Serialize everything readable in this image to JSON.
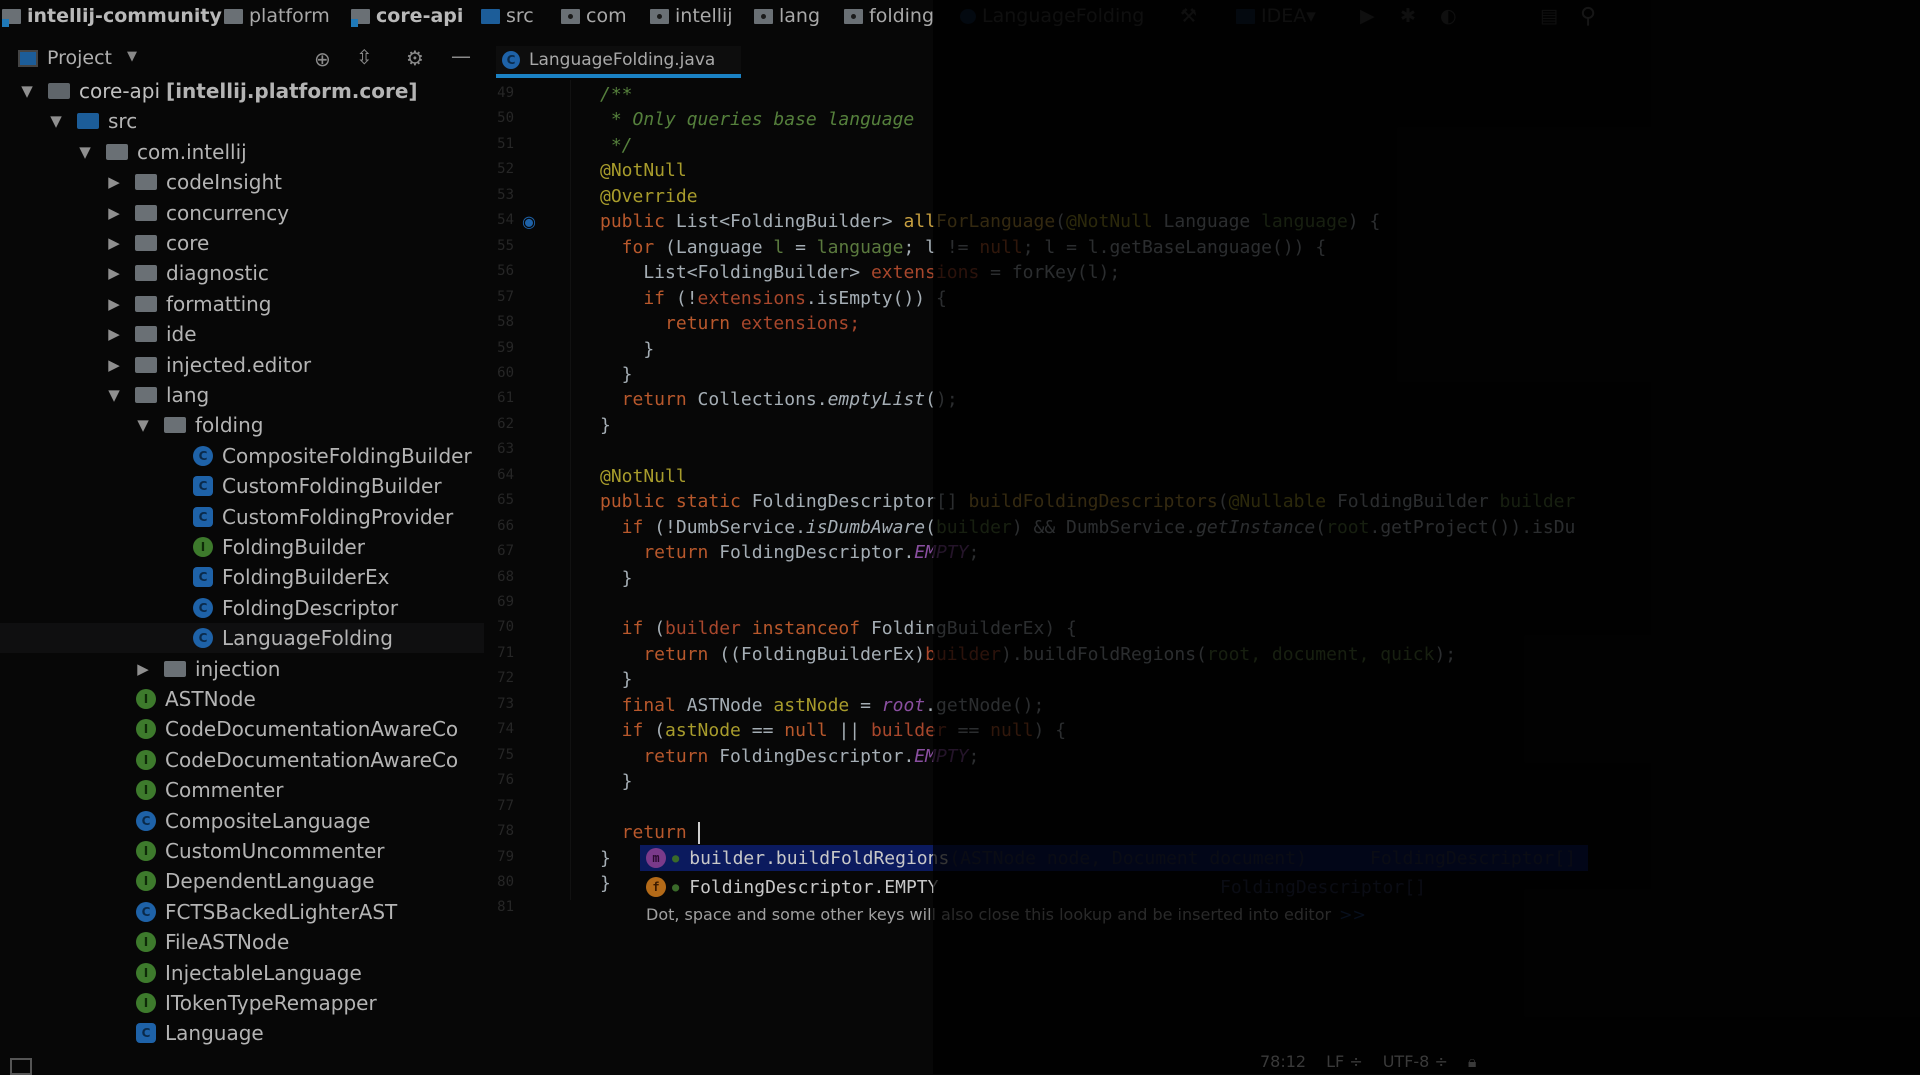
{
  "navbar": {
    "crumbs": [
      {
        "label": "intellij-community",
        "kind": "mod",
        "bold": true
      },
      {
        "label": "platform",
        "kind": "plain",
        "bold": false
      },
      {
        "label": "core-api",
        "kind": "mod",
        "bold": true
      },
      {
        "label": "src",
        "kind": "src",
        "bold": false
      },
      {
        "label": "com",
        "kind": "pkg",
        "bold": false
      },
      {
        "label": "intellij",
        "kind": "pkg",
        "bold": false
      },
      {
        "label": "lang",
        "kind": "pkg",
        "bold": false
      },
      {
        "label": "folding",
        "kind": "pkg",
        "bold": false
      },
      {
        "label": "LanguageFolding",
        "kind": "class",
        "bold": false
      }
    ],
    "run_config": "IDEA"
  },
  "project_panel": {
    "title": "Project",
    "tree": [
      {
        "label": "core-api",
        "suffix": "[intellij.platform.core]",
        "level": 0,
        "arrow": "down",
        "icon": "module"
      },
      {
        "label": "src",
        "level": 1,
        "arrow": "down",
        "icon": "src"
      },
      {
        "label": "com.intellij",
        "level": 2,
        "arrow": "down",
        "icon": "folder"
      },
      {
        "label": "codeInsight",
        "level": 3,
        "arrow": "right",
        "icon": "folder"
      },
      {
        "label": "concurrency",
        "level": 3,
        "arrow": "right",
        "icon": "folder"
      },
      {
        "label": "core",
        "level": 3,
        "arrow": "right",
        "icon": "folder"
      },
      {
        "label": "diagnostic",
        "level": 3,
        "arrow": "right",
        "icon": "folder"
      },
      {
        "label": "formatting",
        "level": 3,
        "arrow": "right",
        "icon": "folder"
      },
      {
        "label": "ide",
        "level": 3,
        "arrow": "right",
        "icon": "folder"
      },
      {
        "label": "injected.editor",
        "level": 3,
        "arrow": "right",
        "icon": "folder"
      },
      {
        "label": "lang",
        "level": 3,
        "arrow": "down",
        "icon": "folder"
      },
      {
        "label": "folding",
        "level": 4,
        "arrow": "down",
        "icon": "folder"
      },
      {
        "label": "CompositeFoldingBuilder",
        "level": 5,
        "icon": "c"
      },
      {
        "label": "CustomFoldingBuilder",
        "level": 5,
        "icon": "cabs"
      },
      {
        "label": "CustomFoldingProvider",
        "level": 5,
        "icon": "cabs"
      },
      {
        "label": "FoldingBuilder",
        "level": 5,
        "icon": "i"
      },
      {
        "label": "FoldingBuilderEx",
        "level": 5,
        "icon": "cabs"
      },
      {
        "label": "FoldingDescriptor",
        "level": 5,
        "icon": "c"
      },
      {
        "label": "LanguageFolding",
        "level": 5,
        "icon": "c",
        "selected": true
      },
      {
        "label": "injection",
        "level": 4,
        "arrow": "right",
        "icon": "folder"
      },
      {
        "label": "ASTNode",
        "level": 4,
        "icon": "i"
      },
      {
        "label": "CodeDocumentationAwareCo",
        "level": 4,
        "icon": "i"
      },
      {
        "label": "CodeDocumentationAwareCo",
        "level": 4,
        "icon": "i"
      },
      {
        "label": "Commenter",
        "level": 4,
        "icon": "i"
      },
      {
        "label": "CompositeLanguage",
        "level": 4,
        "icon": "c"
      },
      {
        "label": "CustomUncommenter",
        "level": 4,
        "icon": "i"
      },
      {
        "label": "DependentLanguage",
        "level": 4,
        "icon": "i"
      },
      {
        "label": "FCTSBackedLighterAST",
        "level": 4,
        "icon": "c"
      },
      {
        "label": "FileASTNode",
        "level": 4,
        "icon": "i"
      },
      {
        "label": "InjectableLanguage",
        "level": 4,
        "icon": "i"
      },
      {
        "label": "ITokenTypeRemapper",
        "level": 4,
        "icon": "i"
      },
      {
        "label": "Language",
        "level": 4,
        "icon": "cabs"
      }
    ]
  },
  "editor": {
    "tab_label": "LanguageFolding.java",
    "lines": [
      {
        "n": "49",
        "t": [
          [
            "/**",
            "cm"
          ]
        ]
      },
      {
        "n": "50",
        "t": [
          [
            " * Only queries base language",
            "cm"
          ]
        ]
      },
      {
        "n": "51",
        "t": [
          [
            " */",
            "cm"
          ]
        ]
      },
      {
        "n": "52",
        "t": [
          [
            "@NotNull",
            "an"
          ]
        ]
      },
      {
        "n": "53",
        "t": [
          [
            "@Override",
            "an"
          ]
        ]
      },
      {
        "n": "54",
        "t": [
          [
            "public ",
            "kw"
          ],
          [
            "List<FoldingBuilder> ",
            ""
          ],
          [
            "allForLanguage",
            "fn"
          ],
          [
            "(",
            ""
          ],
          [
            "@NotNull ",
            "an"
          ],
          [
            "Language ",
            ""
          ],
          [
            "language",
            "pm"
          ],
          [
            ") {",
            ""
          ]
        ]
      },
      {
        "n": "55",
        "t": [
          [
            "  for ",
            "kw"
          ],
          [
            "(Language ",
            ""
          ],
          [
            "l",
            "pm"
          ],
          [
            " = ",
            ""
          ],
          [
            "language",
            "pm"
          ],
          [
            "; ",
            ""
          ],
          [
            "l",
            ""
          ],
          [
            " != ",
            ""
          ],
          [
            "null",
            "kw"
          ],
          [
            "; ",
            ""
          ],
          [
            "l",
            ""
          ],
          [
            " = ",
            ""
          ],
          [
            "l",
            ""
          ],
          [
            ".getBaseLanguage()) {",
            ""
          ]
        ]
      },
      {
        "n": "56",
        "t": [
          [
            "    List<FoldingBuilder> ",
            ""
          ],
          [
            "extensions",
            "lv"
          ],
          [
            " = forKey(",
            ""
          ],
          [
            "l",
            ""
          ],
          [
            ");",
            ""
          ]
        ]
      },
      {
        "n": "57",
        "t": [
          [
            "    if ",
            "kw"
          ],
          [
            "(!",
            ""
          ],
          [
            "extensions",
            "lv"
          ],
          [
            ".isEmpty()) {",
            ""
          ]
        ]
      },
      {
        "n": "58",
        "t": [
          [
            "      return ",
            "kw"
          ],
          [
            "extensions;",
            "lv"
          ]
        ]
      },
      {
        "n": "59",
        "t": [
          [
            "    }",
            ""
          ]
        ]
      },
      {
        "n": "60",
        "t": [
          [
            "  }",
            ""
          ]
        ]
      },
      {
        "n": "61",
        "t": [
          [
            "  return ",
            "kw"
          ],
          [
            "Collections.",
            ""
          ],
          [
            "emptyList",
            "it"
          ],
          [
            "();",
            ""
          ]
        ]
      },
      {
        "n": "62",
        "t": [
          [
            "}",
            ""
          ]
        ]
      },
      {
        "n": "63",
        "t": []
      },
      {
        "n": "64",
        "t": [
          [
            "@NotNull",
            "an"
          ]
        ]
      },
      {
        "n": "65",
        "t": [
          [
            "public static ",
            "kw"
          ],
          [
            "FoldingDescriptor[] ",
            ""
          ],
          [
            "buildFoldingDescriptors",
            "fn"
          ],
          [
            "(",
            ""
          ],
          [
            "@Nullable ",
            "an"
          ],
          [
            "FoldingBuilder ",
            ""
          ],
          [
            "builder",
            "pm"
          ]
        ]
      },
      {
        "n": "66",
        "t": [
          [
            "  if ",
            "kw"
          ],
          [
            "(!DumbService.",
            ""
          ],
          [
            "isDumbAware",
            "it"
          ],
          [
            "(",
            ""
          ],
          [
            "builder",
            "pm"
          ],
          [
            ") && DumbService.",
            ""
          ],
          [
            "getInstance",
            "it"
          ],
          [
            "(",
            ""
          ],
          [
            "root",
            "pm"
          ],
          [
            ".getProject()).isDu",
            ""
          ]
        ]
      },
      {
        "n": "67",
        "t": [
          [
            "    return ",
            "kw"
          ],
          [
            "FoldingDescriptor.",
            ""
          ],
          [
            "EMPTY",
            "st"
          ],
          [
            ";",
            ""
          ]
        ]
      },
      {
        "n": "68",
        "t": [
          [
            "  }",
            ""
          ]
        ]
      },
      {
        "n": "69",
        "t": []
      },
      {
        "n": "70",
        "t": [
          [
            "  if ",
            "kw"
          ],
          [
            "(",
            ""
          ],
          [
            "builder ",
            "lv"
          ],
          [
            "instanceof ",
            "kw"
          ],
          [
            "FoldingBuilderEx) {",
            ""
          ]
        ]
      },
      {
        "n": "71",
        "t": [
          [
            "    return ",
            "kw"
          ],
          [
            "((FoldingBuilderEx)",
            ""
          ],
          [
            "builder",
            "lv"
          ],
          [
            ").buildFoldRegions(",
            ""
          ],
          [
            "root, document, quick",
            "pm"
          ],
          [
            ");",
            ""
          ]
        ]
      },
      {
        "n": "72",
        "t": [
          [
            "  }",
            ""
          ]
        ]
      },
      {
        "n": "73",
        "t": [
          [
            "  final ",
            "kw"
          ],
          [
            "ASTNode ",
            ""
          ],
          [
            "astNode",
            "an"
          ],
          [
            " = ",
            ""
          ],
          [
            "root",
            "st"
          ],
          [
            ".getNode();",
            ""
          ]
        ]
      },
      {
        "n": "74",
        "t": [
          [
            "  if ",
            "kw"
          ],
          [
            "(",
            ""
          ],
          [
            "astNode",
            "an"
          ],
          [
            " == ",
            ""
          ],
          [
            "null ",
            "kw"
          ],
          [
            "|| ",
            ""
          ],
          [
            "builder",
            "lv"
          ],
          [
            " == ",
            ""
          ],
          [
            "null",
            "kw"
          ],
          [
            ") {",
            ""
          ]
        ]
      },
      {
        "n": "75",
        "t": [
          [
            "    return ",
            "kw"
          ],
          [
            "FoldingDescriptor.",
            ""
          ],
          [
            "EMPTY",
            "st"
          ],
          [
            ";",
            ""
          ]
        ]
      },
      {
        "n": "76",
        "t": [
          [
            "  }",
            ""
          ]
        ]
      },
      {
        "n": "77",
        "t": []
      },
      {
        "n": "78",
        "t": [
          [
            "  return ",
            "kw"
          ]
        ],
        "caret": true
      },
      {
        "n": "79",
        "t": [
          [
            "}",
            ""
          ]
        ]
      },
      {
        "n": "80",
        "t": [
          [
            "}",
            ""
          ]
        ]
      },
      {
        "n": "81",
        "t": []
      }
    ]
  },
  "completion": {
    "items": [
      {
        "icon": "m",
        "text": "builder.buildFoldRegions",
        "params": "(ASTNode node, Document document)",
        "type": "FoldingDescriptor[]",
        "selected": true
      },
      {
        "icon": "f",
        "text": "FoldingDescriptor.EMPTY",
        "params": "",
        "type": "FoldingDescriptor[]",
        "selected": false
      }
    ],
    "hint": "Dot, space and some other keys will also close this lookup and be inserted into editor",
    "hint_link": ">>"
  },
  "status": {
    "position": "78:12",
    "line_sep": "LF ÷",
    "encoding": "UTF-8 ÷"
  },
  "colors": {
    "accent": "#1b82c4",
    "selection": "#0b1a5e",
    "keyword": "#cc7832",
    "annotation": "#bbb529"
  }
}
